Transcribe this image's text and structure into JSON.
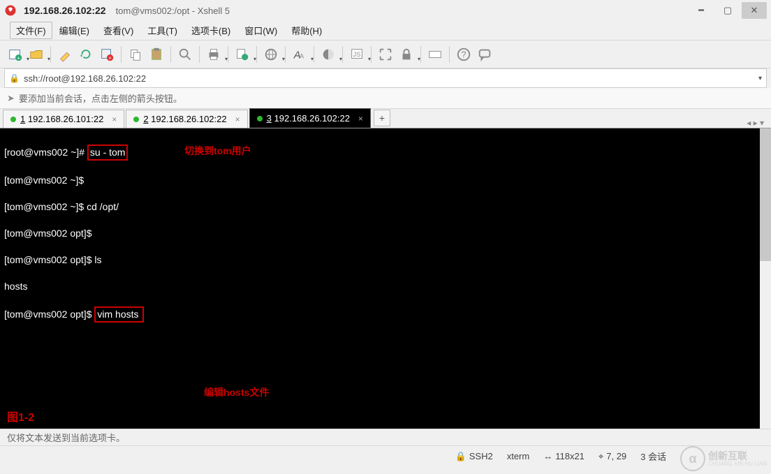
{
  "title": {
    "host": "192.168.26.102:22",
    "subtitle": "tom@vms002:/opt - Xshell 5"
  },
  "menu": {
    "file": "文件(F)",
    "edit": "编辑(E)",
    "view": "查看(V)",
    "tools": "工具(T)",
    "tabs": "选项卡(B)",
    "window": "窗口(W)",
    "help": "帮助(H)"
  },
  "address": {
    "url": "ssh://root@192.168.26.102:22"
  },
  "hint": "要添加当前会话，点击左侧的箭头按钮。",
  "tabs": [
    {
      "num": "1",
      "label": "192.168.26.101:22",
      "active": false
    },
    {
      "num": "2",
      "label": "192.168.26.102:22",
      "active": false
    },
    {
      "num": "3",
      "label": "192.168.26.102:22",
      "active": true
    }
  ],
  "terminal": {
    "line1_prefix": "[root@vms002 ~]# ",
    "line1_box": "su - tom",
    "line1_ann": "切换到tom用户",
    "line2": "[tom@vms002 ~]$",
    "line3": "[tom@vms002 ~]$ cd /opt/",
    "line4": "[tom@vms002 opt]$",
    "line5": "[tom@vms002 opt]$ ls",
    "line6": "hosts",
    "line7_prefix": "[tom@vms002 opt]$ ",
    "line7_box": "vim hosts ",
    "line7_ann": "编辑hosts文件",
    "figure": "图1-2"
  },
  "footer1": "仅将文本发送到当前选项卡。",
  "status": {
    "ssh": "SSH2",
    "term": "xterm",
    "size": "118x21",
    "cursor": "7, 29",
    "sessions": "3 会话"
  },
  "watermark": {
    "main": "创新互联",
    "sub": "CHUANG XIN HU LIAN"
  }
}
